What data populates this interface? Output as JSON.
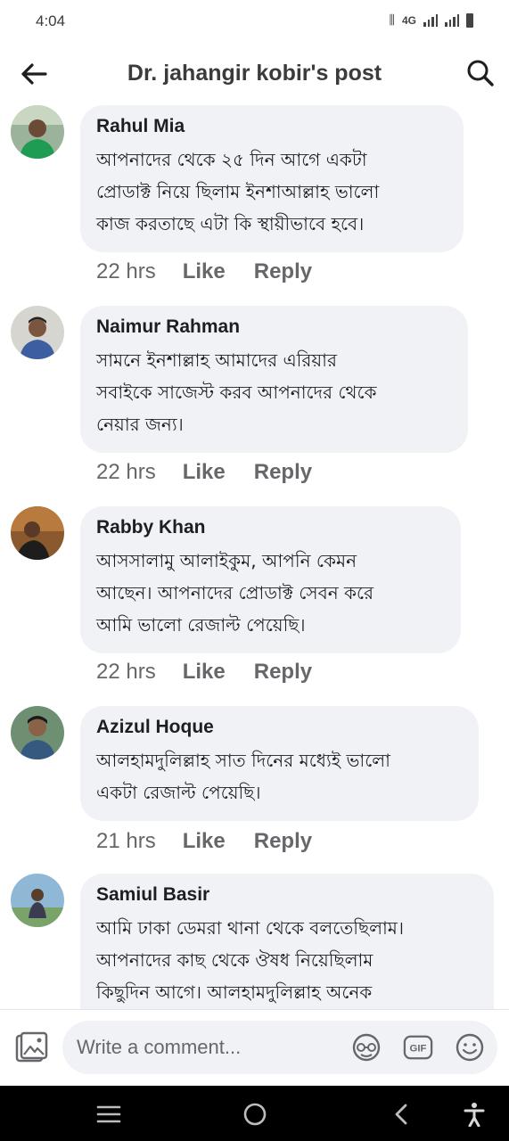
{
  "status_bar": {
    "time": "4:04",
    "network": "4G"
  },
  "header": {
    "title": "Dr. jahangir kobir's post"
  },
  "comments": [
    {
      "author": "Rahul Mia",
      "lines": [
        "আপনাদের থেকে ২৫ দিন আগে একটা",
        "প্রোডাক্ট নিয়ে ছিলাম ইনশাআল্লাহ ভালো",
        "কাজ করতাছে এটা কি স্থায়ীভাবে হবে।"
      ],
      "time": "22 hrs",
      "like": "Like",
      "reply": "Reply"
    },
    {
      "author": "Naimur Rahman",
      "lines": [
        "সামনে ইনশাল্লাহ আমাদের এরিয়ার",
        "সবাইকে সাজেস্ট করব আপনাদের থেকে",
        "নেয়ার জন্য।"
      ],
      "time": "22 hrs",
      "like": "Like",
      "reply": "Reply"
    },
    {
      "author": "Rabby Khan",
      "lines": [
        "আসসালামু আলাইকুম, আপনি কেমন",
        "আছেন। আপনাদের প্রোডাক্ট সেবন করে",
        "আমি ভালো রেজাল্ট পেয়েছি।"
      ],
      "time": "22 hrs",
      "like": "Like",
      "reply": "Reply"
    },
    {
      "author": "Azizul Hoque",
      "lines": [
        "আলহামদুলিল্লাহ সাত দিনের মধ্যেই ভালো",
        "একটা রেজাল্ট পেয়েছি।"
      ],
      "time": "21 hrs",
      "like": "Like",
      "reply": "Reply"
    },
    {
      "author": "Samiul Basir",
      "lines": [
        "আমি ঢাকা ডেমরা থানা থেকে বলতেছিলাম।",
        "আপনাদের কাছ থেকে ঔষধ নিয়েছিলাম",
        "কিছুদিন আগে। আলহামদুলিল্লাহ অনেক"
      ],
      "time": "",
      "like": "",
      "reply": ""
    }
  ],
  "composer": {
    "placeholder": "Write a comment...",
    "gif_label": "GIF"
  },
  "icons": {
    "back": "back-arrow-icon",
    "search": "search-icon",
    "photo": "photo-icon",
    "avatar": "avatar-icon",
    "gif": "gif-icon",
    "emoji": "emoji-icon",
    "menu": "menu-icon",
    "home": "home-icon",
    "nav_back": "nav-back-icon",
    "accessibility": "accessibility-icon"
  },
  "colors": {
    "bubble": "#f0f2f5",
    "secondary_text": "#65676b",
    "primary_text": "#1c1e21",
    "navbar": "#000000"
  }
}
